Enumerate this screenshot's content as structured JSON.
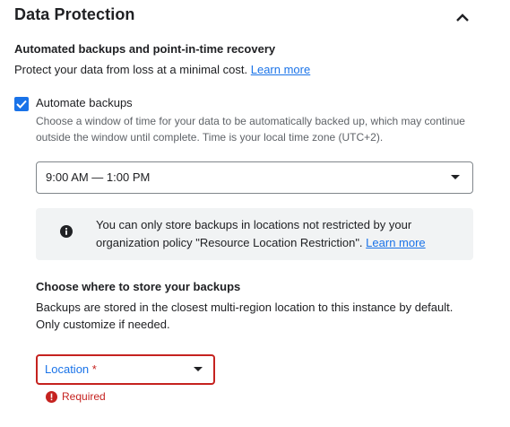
{
  "section": {
    "title": "Data Protection",
    "collapse_icon": "chevron-up-icon"
  },
  "backups": {
    "heading": "Automated backups and point-in-time recovery",
    "description": "Protect your data from loss at a minimal cost.",
    "learn_more": "Learn more",
    "automate": {
      "checked": true,
      "label": "Automate backups",
      "helper": "Choose a window of time for your data to be automatically backed up, which may continue outside the window until complete. Time is your local time zone (UTC+2)."
    },
    "window_select": {
      "value": "9:00 AM — 1:00 PM"
    }
  },
  "info": {
    "icon": "info-icon",
    "text": "You can only store backups in locations not restricted by your organization policy \"Resource Location Restriction\".",
    "learn_more": "Learn more"
  },
  "storage": {
    "heading": "Choose where to store your backups",
    "description": "Backups are stored in the closest multi-region location to this instance by default. Only customize if needed.",
    "location_select": {
      "label": "Location",
      "required_mark": "*"
    },
    "error": {
      "icon": "error-icon",
      "text": "Required"
    }
  },
  "colors": {
    "accent": "#1a73e8",
    "error": "#c5221f",
    "info_bg": "#f1f3f4"
  }
}
